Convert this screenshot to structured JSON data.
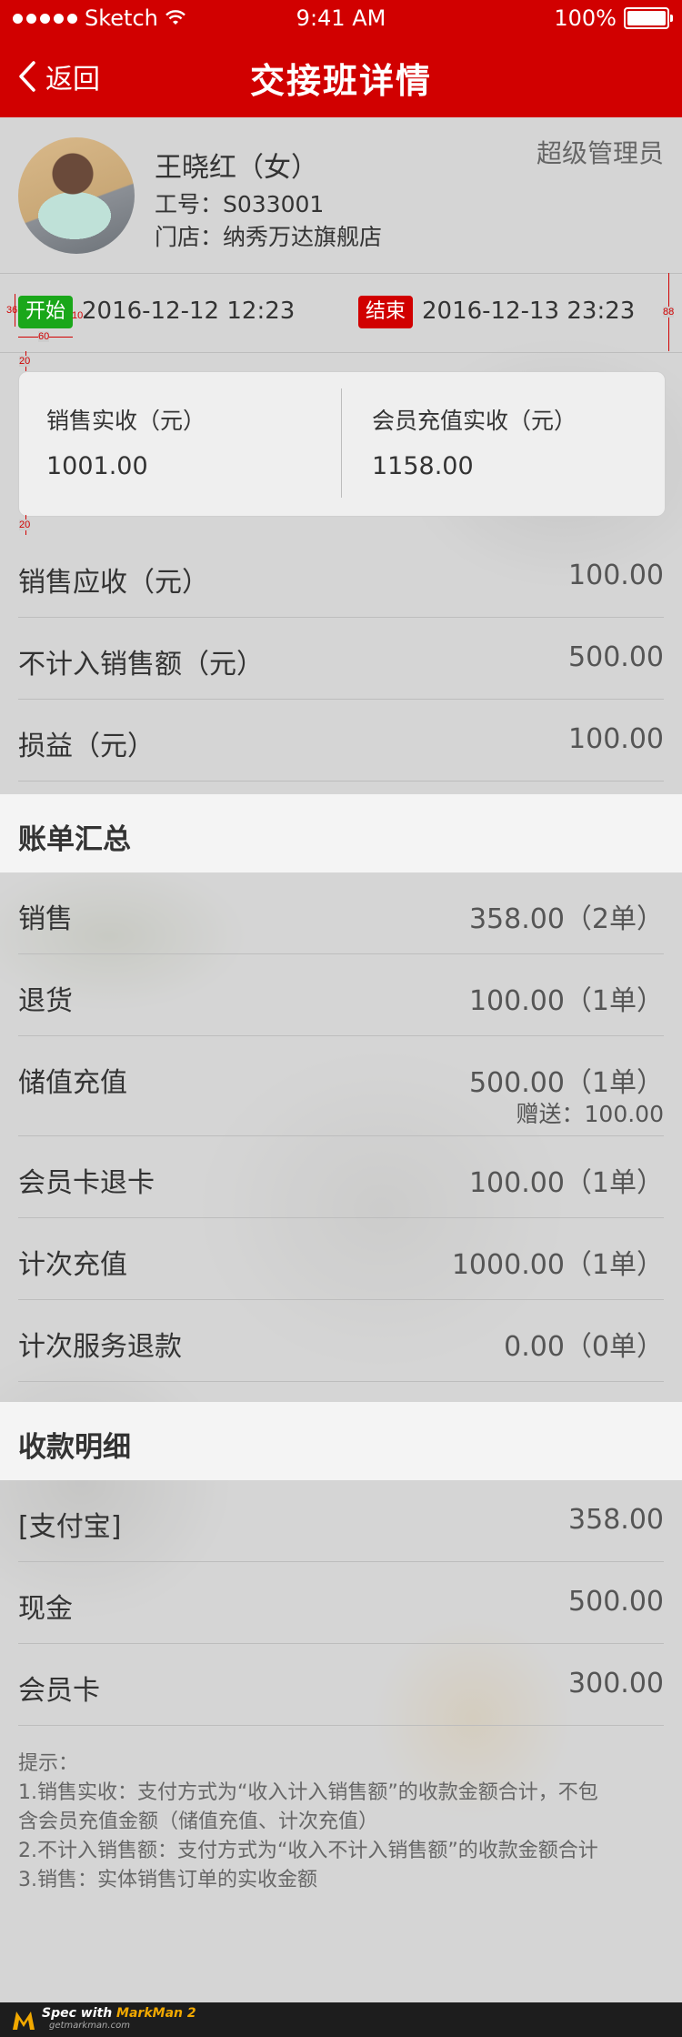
{
  "status_bar": {
    "carrier": "Sketch",
    "time": "9:41 AM",
    "battery": "100%"
  },
  "nav": {
    "back_label": "返回",
    "title": "交接班详情"
  },
  "profile": {
    "name": "王晓红（女）",
    "employee_id": "工号：S033001",
    "store": "门店：纳秀万达旗舰店",
    "role": "超级管理员"
  },
  "shift": {
    "start_tag": "开始",
    "start_time": "2016-12-12 12:23",
    "end_tag": "结束",
    "end_time": "2016-12-13 23:23"
  },
  "summary": {
    "sales_received_label": "销售实收（元）",
    "sales_received_value": "1001.00",
    "member_recharge_label": "会员充值实收（元）",
    "member_recharge_value": "1158.00"
  },
  "totals": [
    {
      "label": "销售应收（元）",
      "value": "100.00"
    },
    {
      "label": "不计入销售额（元）",
      "value": "500.00"
    },
    {
      "label": "损益（元）",
      "value": "100.00"
    }
  ],
  "bill_summary": {
    "title": "账单汇总",
    "rows": [
      {
        "label": "销售",
        "value": "358.00（2单）"
      },
      {
        "label": "退货",
        "value": "100.00（1单）"
      },
      {
        "label": "储值充值",
        "value": "500.00（1单）",
        "sub": "赠送：100.00"
      },
      {
        "label": "会员卡退卡",
        "value": "100.00（1单）"
      },
      {
        "label": "计次充值",
        "value": "1000.00（1单）"
      },
      {
        "label": "计次服务退款",
        "value": "0.00（0单）"
      }
    ]
  },
  "payment_detail": {
    "title": "收款明细",
    "rows": [
      {
        "label": "[支付宝]",
        "value": "358.00"
      },
      {
        "label": "现金",
        "value": "500.00"
      },
      {
        "label": "会员卡",
        "value": "300.00"
      }
    ]
  },
  "tips": {
    "title": "提示：",
    "lines": [
      "1.销售实收：支付方式为“收入计入销售额”的收款金额合计，不包",
      "含会员充值金额（储值充值、计次充值）",
      "2.不计入销售额：支付方式为“收入不计入销售额”的收款金额合计",
      "3.销售：实体销售订单的实收金额"
    ]
  },
  "annotations": {
    "a36": "36",
    "a10": "10",
    "a60": "60",
    "a88": "88",
    "a20a": "20",
    "a20b": "20"
  },
  "footer": {
    "brand_prefix": "Spec with ",
    "brand": "MarkMan 2",
    "site": "getmarkman.com"
  },
  "colors": {
    "brand_red": "#d10000",
    "start_green": "#1aa71a"
  }
}
